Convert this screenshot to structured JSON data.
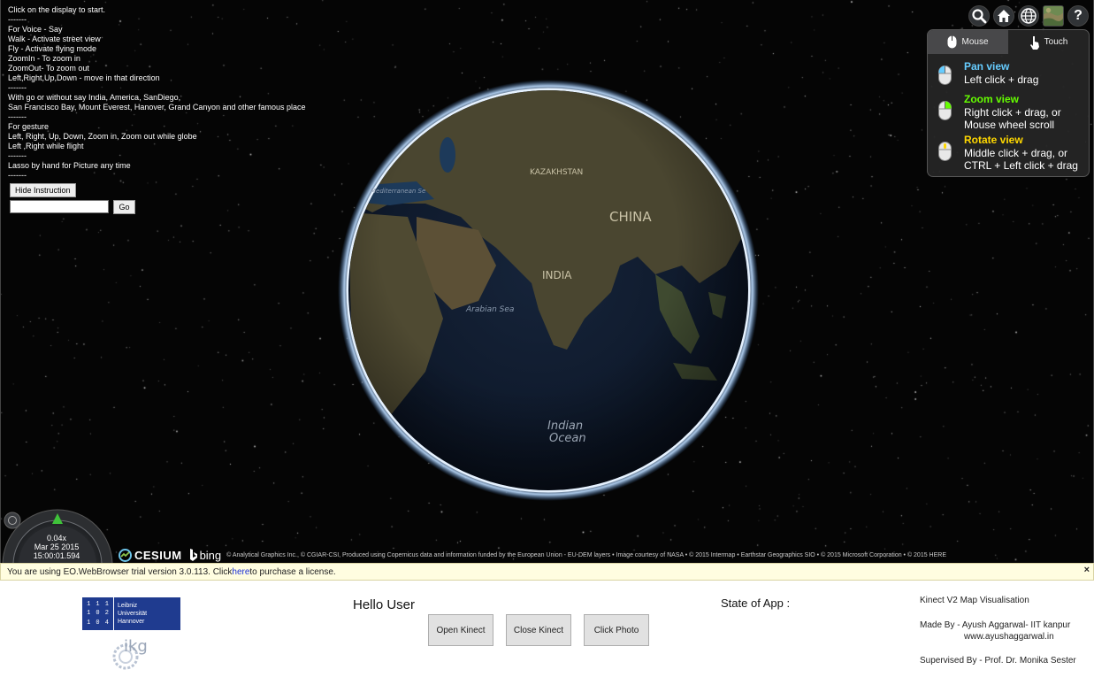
{
  "instructions": {
    "lines": [
      "Click on the display to start.",
      "-------",
      "For Voice - Say",
      "Walk - Activate street view",
      "Fly - Activate flying mode",
      "ZoomIn - To zoom in",
      "ZoomOut- To zoom out",
      "Left,Right,Up,Down - move in that direction",
      "-------",
      "With go or without say India, America, SanDiego,",
      "San Francisco Bay, Mount Everest, Hanover, Grand Canyon and other famous place",
      "-------",
      "For gesture",
      "Left, Right, Up, Down, Zoom in, Zoom out while globe",
      "Left ,Right while flight",
      "-------",
      "Lasso by hand for Picture any time",
      "-------"
    ],
    "hide_button": "Hide Instruction",
    "search_value": "",
    "go_button": "Go"
  },
  "toolbar": {
    "icons": [
      "search-icon",
      "home-icon",
      "globe-icon",
      "imagery-picker-icon",
      "help-icon"
    ],
    "help_glyph": "?"
  },
  "nav_help": {
    "tab_mouse": "Mouse",
    "tab_touch": "Touch",
    "items": [
      {
        "title": "Pan view",
        "color": "#66ccff",
        "desc1": "Left click + drag",
        "desc2": ""
      },
      {
        "title": "Zoom view",
        "color": "#65fd00",
        "desc1": "Right click + drag, or",
        "desc2": "Mouse wheel scroll"
      },
      {
        "title": "Rotate view",
        "color": "#ffd800",
        "desc1": "Middle click + drag, or",
        "desc2": "CTRL + Left click + drag"
      }
    ]
  },
  "globe_labels": {
    "china": "CHINA",
    "india": "INDIA",
    "arabian_sea": "Arabian Sea",
    "mediterranean": "Mediterranean Se",
    "indian_ocean_1": "Indian",
    "indian_ocean_2": "Ocean",
    "kazakhstan": "KAZAKHSTAN"
  },
  "animation": {
    "speed": "0.04x",
    "date": "Mar 25 2015",
    "time": "15:00:01.594"
  },
  "credits": {
    "cesium": "CESIUM",
    "bing": "bing",
    "text": "© Analytical Graphics Inc., © CGIAR-CSI, Produced using Copernicus data and information funded by the European Union - EU-DEM layers • Image courtesy of NASA • © 2015 Intermap • Earthstar Geographics SIO • © 2015 Microsoft Corporation • © 2015 HERE"
  },
  "license": {
    "prefix": "You are using EO.WebBrowser trial version 3.0.113. Click",
    "link": "here",
    "suffix": " to purchase a license.",
    "close": "×"
  },
  "app": {
    "logo_luh_grid": [
      "1",
      "1",
      "1",
      "1",
      "0",
      "2",
      "1",
      "0",
      "4"
    ],
    "logo_luh_text": [
      "Leibniz",
      "Universität",
      "Hannover"
    ],
    "logo_ikg": "ikg",
    "greeting": "Hello User",
    "open_kinect": "Open Kinect",
    "close_kinect": "Close Kinect",
    "click_photo": "Click Photo",
    "state_label": "State of App :",
    "title": "Kinect V2 Map Visualisation",
    "made_by": "Made By - Ayush Aggarwal- IIT kanpur",
    "website": "www.ayushaggarwal.in",
    "supervised_by": "Supervised By - Prof. Dr. Monika Sester"
  }
}
